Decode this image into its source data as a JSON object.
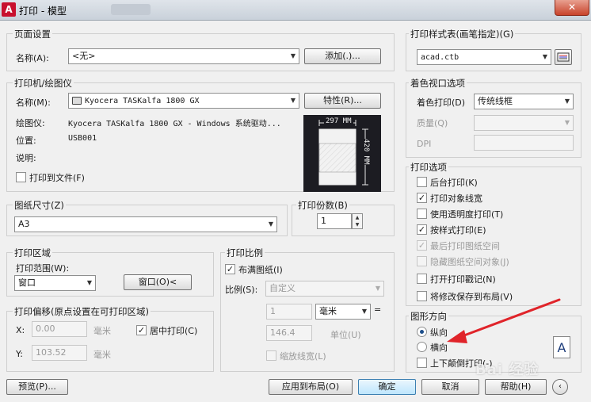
{
  "window": {
    "logo": "A",
    "title": "打印 - 模型",
    "close": "✕"
  },
  "page_setup": {
    "title": "页面设置",
    "name_label": "名称(A):",
    "name_value": "<无>",
    "add_button": "添加(.)..."
  },
  "printer": {
    "title": "打印机/绘图仪",
    "name_label": "名称(M):",
    "name_value": "Kyocera TASKalfa 1800 GX",
    "properties_button": "特性(R)...",
    "plotter_label": "绘图仪:",
    "plotter_value": "Kyocera TASKalfa 1800 GX - Windows 系统驱动...",
    "location_label": "位置:",
    "location_value": "USB001",
    "description_label": "说明:",
    "print_to_file": "打印到文件(F)",
    "preview_width": "297 MM",
    "preview_height": "420 MM"
  },
  "paper_size": {
    "title": "图纸尺寸(Z)",
    "value": "A3"
  },
  "copies": {
    "title": "打印份数(B)",
    "value": "1"
  },
  "plot_area": {
    "title": "打印区域",
    "range_label": "打印范围(W):",
    "range_value": "窗口",
    "window_button": "窗口(O)<"
  },
  "plot_offset": {
    "title": "打印偏移(原点设置在可打印区域)",
    "x_label": "X:",
    "x_value": "0.00",
    "x_unit": "毫米",
    "center_plot": "居中打印(C)",
    "y_label": "Y:",
    "y_value": "103.52",
    "y_unit": "毫米"
  },
  "plot_scale": {
    "title": "打印比例",
    "fit_to_paper": "布满图纸(I)",
    "scale_label": "比例(S):",
    "scale_value": "自定义",
    "value1": "1",
    "unit_value": "毫米",
    "equals": "=",
    "value2": "146.4",
    "unit_label": "单位(U)",
    "scale_lineweights": "缩放线宽(L)"
  },
  "plot_style_table": {
    "title": "打印样式表(画笔指定)(G)",
    "value": "acad.ctb"
  },
  "shaded_viewport": {
    "title": "着色视口选项",
    "shade_plot_label": "着色打印(D)",
    "shade_plot_value": "传统线框",
    "quality_label": "质量(Q)",
    "dpi_label": "DPI"
  },
  "plot_options": {
    "title": "打印选项",
    "items": [
      {
        "label": "后台打印(K)",
        "checked": "",
        "disabled": false
      },
      {
        "label": "打印对象线宽",
        "checked": "✓",
        "disabled": false
      },
      {
        "label": "使用透明度打印(T)",
        "checked": "",
        "disabled": false
      },
      {
        "label": "按样式打印(E)",
        "checked": "✓",
        "disabled": false
      },
      {
        "label": "最后打印图纸空间",
        "checked": "✓",
        "disabled": true
      },
      {
        "label": "隐藏图纸空间对象(J)",
        "checked": "",
        "disabled": true
      },
      {
        "label": "打开打印戳记(N)",
        "checked": "",
        "disabled": false
      },
      {
        "label": "将修改保存到布局(V)",
        "checked": "",
        "disabled": false
      }
    ]
  },
  "orientation": {
    "title": "图形方向",
    "portrait": "纵向",
    "landscape": "横向",
    "upside_down": "上下颠倒打印(-)",
    "icon_letter": "A",
    "arrow_color": "#e0242a"
  },
  "footer": {
    "preview_button": "预览(P)...",
    "apply_button": "应用到布局(O)",
    "ok_button": "确定",
    "cancel_button": "取消",
    "help_button": "帮助(H)"
  },
  "watermark": "Bai 经验"
}
